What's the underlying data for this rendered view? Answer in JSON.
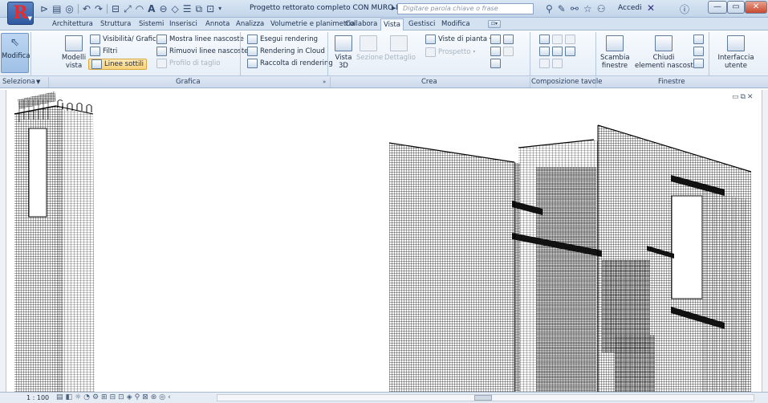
{
  "titlebar": {
    "app_letter": "R",
    "document_title": "Progetto rettorato completo CON MURO INCLI...",
    "search_placeholder": "Digitare parola chiave o frase",
    "signin": "Accedi",
    "qat_icons": [
      "open-icon",
      "save-icon",
      "sync-icon",
      "undo-icon",
      "redo-icon",
      "print-icon",
      "measure-icon",
      "text-icon",
      "3d-icon",
      "switch-windows-icon"
    ]
  },
  "tabs": [
    {
      "label": "Architettura"
    },
    {
      "label": "Struttura"
    },
    {
      "label": "Sistemi"
    },
    {
      "label": "Inserisci"
    },
    {
      "label": "Annota"
    },
    {
      "label": "Analizza"
    },
    {
      "label": "Volumetrie e planimetria"
    },
    {
      "label": "Collabora"
    },
    {
      "label": "Vista",
      "active": true
    },
    {
      "label": "Gestisci"
    },
    {
      "label": "Modifica"
    }
  ],
  "ribbon": {
    "modifica": "Modifica",
    "modelli_vista_line1": "Modelli",
    "modelli_vista_line2": "vista",
    "visibilita": "Visibilità/ Grafica",
    "filtri": "Filtri",
    "linee_sottili": "Linee sottili",
    "mostra_linee": "Mostra linee nascoste",
    "rimuovi_linee": "Rimuovi linee nascoste",
    "profilo_taglio": "Profilo di taglio",
    "esegui_rendering": "Esegui rendering",
    "rendering_cloud": "Rendering in Cloud",
    "raccolta_rendering": "Raccolta di rendering",
    "vista3d_line1": "Vista",
    "vista3d_line2": "3D",
    "sezione": "Sezione",
    "dettaglio": "Dettaglio",
    "viste_pianta": "Viste di pianta",
    "prospetto": "Prospetto",
    "scambia_line1": "Scambia",
    "scambia_line2": "finestre",
    "chiudi_line1": "Chiudi",
    "chiudi_line2": "elementi nascosti",
    "interfaccia_line1": "Interfaccia",
    "interfaccia_line2": "utente"
  },
  "panels": {
    "seleziona": "Seleziona",
    "grafica": "Grafica",
    "crea": "Crea",
    "composizione": "Composizione tavole",
    "finestre": "Finestre"
  },
  "status": {
    "scale": "1 : 100"
  }
}
